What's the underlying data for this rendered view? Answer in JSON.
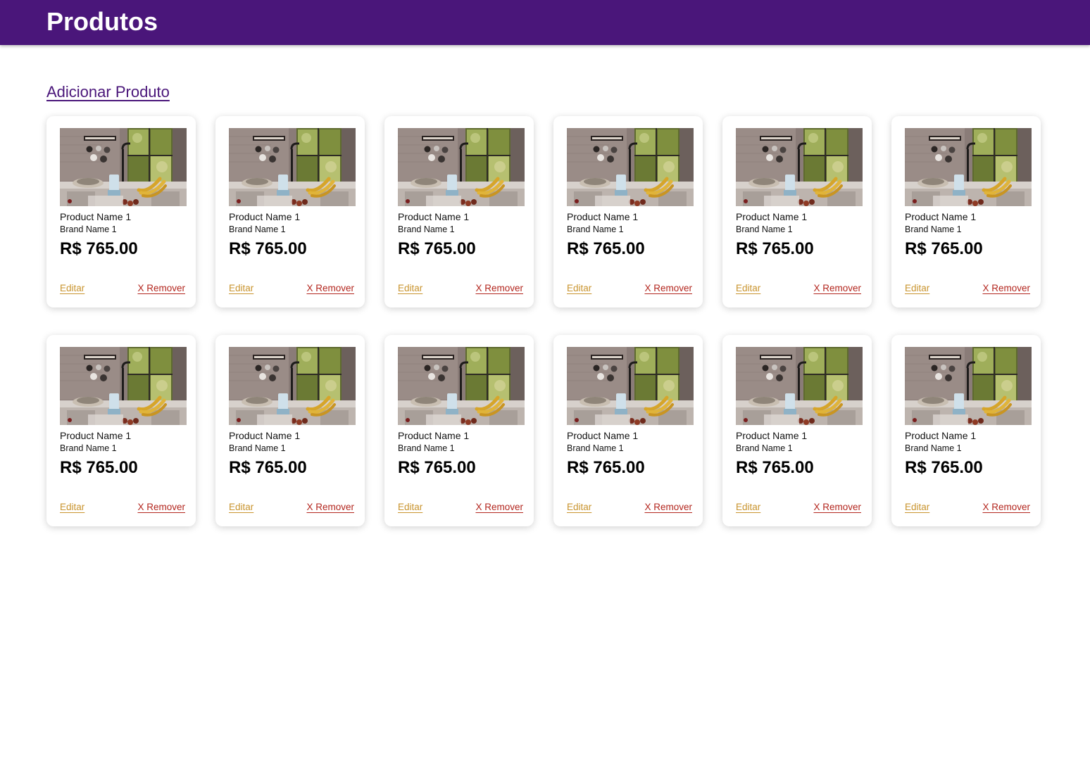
{
  "header": {
    "title": "Produtos"
  },
  "actions": {
    "add_product": "Adicionar Produto"
  },
  "colors": {
    "header_bg": "#4a167a",
    "edit_link": "#c9942e",
    "remove_link": "#b3261e"
  },
  "products": [
    {
      "name": "Product Name 1",
      "brand": "Brand Name 1",
      "price": "R$ 765.00",
      "edit_label": "Editar",
      "remove_label": "X Remover",
      "image": "kitchen-photo"
    },
    {
      "name": "Product Name 1",
      "brand": "Brand Name 1",
      "price": "R$ 765.00",
      "edit_label": "Editar",
      "remove_label": "X Remover",
      "image": "kitchen-photo"
    },
    {
      "name": "Product Name 1",
      "brand": "Brand Name 1",
      "price": "R$ 765.00",
      "edit_label": "Editar",
      "remove_label": "X Remover",
      "image": "kitchen-photo"
    },
    {
      "name": "Product Name 1",
      "brand": "Brand Name 1",
      "price": "R$ 765.00",
      "edit_label": "Editar",
      "remove_label": "X Remover",
      "image": "kitchen-photo"
    },
    {
      "name": "Product Name 1",
      "brand": "Brand Name 1",
      "price": "R$ 765.00",
      "edit_label": "Editar",
      "remove_label": "X Remover",
      "image": "kitchen-photo"
    },
    {
      "name": "Product Name 1",
      "brand": "Brand Name 1",
      "price": "R$ 765.00",
      "edit_label": "Editar",
      "remove_label": "X Remover",
      "image": "kitchen-photo"
    },
    {
      "name": "Product Name 1",
      "brand": "Brand Name 1",
      "price": "R$ 765.00",
      "edit_label": "Editar",
      "remove_label": "X Remover",
      "image": "kitchen-photo"
    },
    {
      "name": "Product Name 1",
      "brand": "Brand Name 1",
      "price": "R$ 765.00",
      "edit_label": "Editar",
      "remove_label": "X Remover",
      "image": "kitchen-photo"
    },
    {
      "name": "Product Name 1",
      "brand": "Brand Name 1",
      "price": "R$ 765.00",
      "edit_label": "Editar",
      "remove_label": "X Remover",
      "image": "kitchen-photo"
    },
    {
      "name": "Product Name 1",
      "brand": "Brand Name 1",
      "price": "R$ 765.00",
      "edit_label": "Editar",
      "remove_label": "X Remover",
      "image": "kitchen-photo"
    },
    {
      "name": "Product Name 1",
      "brand": "Brand Name 1",
      "price": "R$ 765.00",
      "edit_label": "Editar",
      "remove_label": "X Remover",
      "image": "kitchen-photo"
    },
    {
      "name": "Product Name 1",
      "brand": "Brand Name 1",
      "price": "R$ 765.00",
      "edit_label": "Editar",
      "remove_label": "X Remover",
      "image": "kitchen-photo"
    }
  ]
}
